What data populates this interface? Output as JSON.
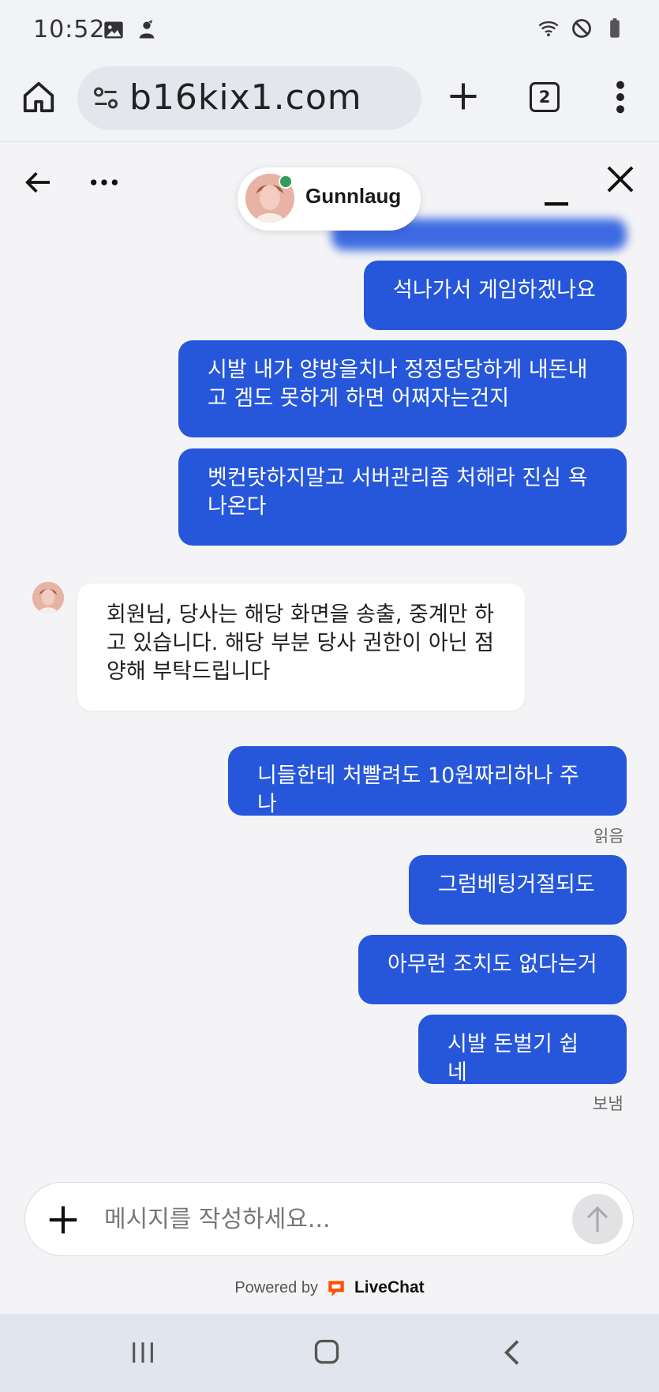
{
  "status_bar": {
    "time": "10:52",
    "left_icons": [
      "image-icon",
      "notification-person-icon"
    ],
    "right_icons": [
      "wifi-off-icon",
      "do-not-disturb-icon",
      "battery-icon"
    ]
  },
  "browser": {
    "url": "b16kix1.com",
    "tab_count": "2",
    "icons": [
      "home-icon",
      "site-info-icon",
      "plus-icon",
      "tabs-icon",
      "more-vert-icon"
    ]
  },
  "chat": {
    "agent_name": "Gunnlaug",
    "agent_online": true,
    "header_icons": [
      "back-arrow-icon",
      "more-horiz-icon",
      "minimize-icon",
      "close-icon"
    ],
    "messages": [
      {
        "from": "user",
        "text": "석나가서 게임하겠나요"
      },
      {
        "from": "user",
        "text": "시발 내가 양방을치나 정정당당하게 내돈내고 겜도 못하게 하면 어쩌자는건지",
        "lines": [
          "시발 내가 양방을치나 정정당당하게 내돈내",
          "고 겜도 못하게 하면 어쩌자는건지"
        ]
      },
      {
        "from": "user",
        "text": "벳컨탓하지말고 서버관리좀 처해라 진심 욕나온다",
        "lines": [
          "벳컨탓하지말고 서버관리좀 처해라 진심 욕",
          "나온다"
        ]
      },
      {
        "from": "agent",
        "text": "회원님, 당사는 해당 화면을 송출, 중계만 하고 있습니다. 해당 부분 당사 권한이 아닌 점 양해 부탁드립니다",
        "lines": [
          "회원님, 당사는 해당 화면을 송출, 중계만 하",
          "고 있습니다. 해당 부분 당사 권한이 아닌 점",
          "양해 부탁드립니다"
        ]
      },
      {
        "from": "user",
        "text": "니들한테 처빨려도 10원짜리하나 주나"
      },
      {
        "from": "user",
        "text": "그럼베팅거절되도"
      },
      {
        "from": "user",
        "text": "아무런 조치도 없다는거"
      },
      {
        "from": "user",
        "text": "시발 돈벌기 쉽네"
      }
    ],
    "status_read": "읽음",
    "status_sent": "보냄",
    "composer": {
      "placeholder": "메시지를 작성하세요...",
      "icons": [
        "plus-icon",
        "send-arrow-up-icon"
      ]
    },
    "powered_by": "Powered by",
    "brand": "LiveChat",
    "brand_color": "#ff5100",
    "accent_color": "#2657db"
  },
  "nav_bar": {
    "icons": [
      "recents-icon",
      "home-outline-icon",
      "back-chevron-icon"
    ]
  }
}
